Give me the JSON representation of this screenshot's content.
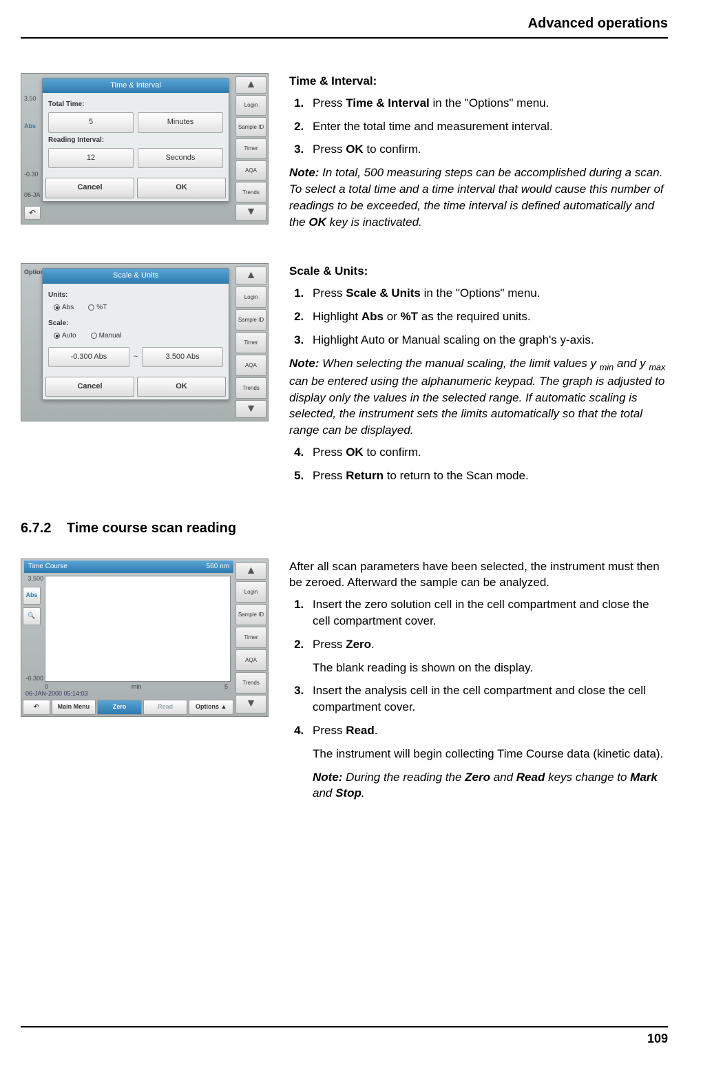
{
  "page": {
    "header": "Advanced operations",
    "number": "109"
  },
  "section1": {
    "title": "Time & Interval:",
    "steps": {
      "s1_a": "Press ",
      "s1_b": "Time & Interval",
      "s1_c": " in the \"Options\" menu.",
      "s2": "Enter the total time and measurement interval.",
      "s3_a": "Press ",
      "s3_b": "OK",
      "s3_c": " to confirm."
    },
    "note_label": "Note:",
    "note_a": " In total, 500 measuring steps can be accomplished during a scan. To select a total time and a time interval that would cause this number of readings to be exceeded, the time interval is defined automatically and the ",
    "note_b": "OK",
    "note_c": " key is inactivated."
  },
  "thumb1": {
    "dialog_title": "Time & Interval",
    "total_time_label": "Total Time:",
    "total_time_value": "5",
    "total_time_unit": "Minutes",
    "interval_label": "Reading Interval:",
    "interval_value": "12",
    "interval_unit": "Seconds",
    "cancel": "Cancel",
    "ok": "OK",
    "left_labels": {
      "a": "3.50",
      "b": "Abs",
      "c": "-0.30",
      "d": "06-JA"
    },
    "sidebar": [
      "Login",
      "Sample ID",
      "Timer",
      "AQA",
      "Trends"
    ]
  },
  "section2": {
    "title": "Scale & Units:",
    "steps": {
      "s1_a": "Press ",
      "s1_b": "Scale & Units",
      "s1_c": " in the \"Options\" menu.",
      "s2_a": "Highlight ",
      "s2_b": "Abs",
      "s2_c": " or ",
      "s2_d": "%T",
      "s2_e": " as the required units.",
      "s3": "Highlight Auto or Manual scaling on the graph's y-axis."
    },
    "note_label": "Note:",
    "note_a": " When selecting the manual scaling, the limit values y ",
    "note_sub1": "min",
    "note_b": " and y ",
    "note_sub2": "max",
    "note_c": " can be entered using the alphanumeric keypad. The graph is adjusted to display only the values in the selected range. If automatic scaling is selected, the instrument sets the limits automatically so that the total range can be displayed.",
    "steps2": {
      "s4_a": "Press ",
      "s4_b": "OK",
      "s4_c": " to confirm.",
      "s5_a": "Press ",
      "s5_b": "Return",
      "s5_c": " to return to the Scan mode."
    }
  },
  "thumb2": {
    "dialog_title": "Scale & Units",
    "units_label": "Units:",
    "abs": "Abs",
    "pt": "%T",
    "scale_label": "Scale:",
    "auto": "Auto",
    "manual": "Manual",
    "low": "-0.300 Abs",
    "high": "3.500 Abs",
    "tilde": "~",
    "cancel": "Cancel",
    "ok": "OK",
    "bg_label": "Options",
    "sidebar": [
      "Login",
      "Sample ID",
      "Timer",
      "AQA",
      "Trends"
    ]
  },
  "heading": {
    "num": "6.7.2",
    "text": "Time course scan reading"
  },
  "section3": {
    "intro": "After all scan parameters have been selected, the instrument must then be zeroed. Afterward the sample can be analyzed.",
    "steps": {
      "s1": "Insert the zero solution cell in the cell compartment and close the cell compartment cover.",
      "s2_a": "Press ",
      "s2_b": "Zero",
      "s2_c": ".",
      "s2_after": "The blank reading is shown on the display.",
      "s3": "Insert the analysis cell in the cell compartment and close the cell compartment cover.",
      "s4_a": "Press ",
      "s4_b": "Read",
      "s4_c": ".",
      "s4_after": "The instrument will begin collecting Time Course data (kinetic data)."
    },
    "note_label": "Note:",
    "note_a": " During the reading the ",
    "note_b": "Zero",
    "note_c": " and ",
    "note_d": "Read",
    "note_e": " keys change to ",
    "note_f": "Mark",
    "note_g": " and ",
    "note_h": "Stop",
    "note_i": "."
  },
  "thumb3": {
    "title_left": "Time Course",
    "title_right": "560 nm",
    "y_top": "3.500",
    "y_bot": "-0.300",
    "x_left": "0",
    "x_mid": "min",
    "x_right": "5",
    "left_btn": "Abs",
    "date": "06-JAN-2000  05:14:03",
    "bb1": "Main Menu",
    "bb2": "Zero",
    "bb3": "Read",
    "bb4": "Options",
    "sidebar": [
      "Login",
      "Sample ID",
      "Timer",
      "AQA",
      "Trends"
    ]
  }
}
